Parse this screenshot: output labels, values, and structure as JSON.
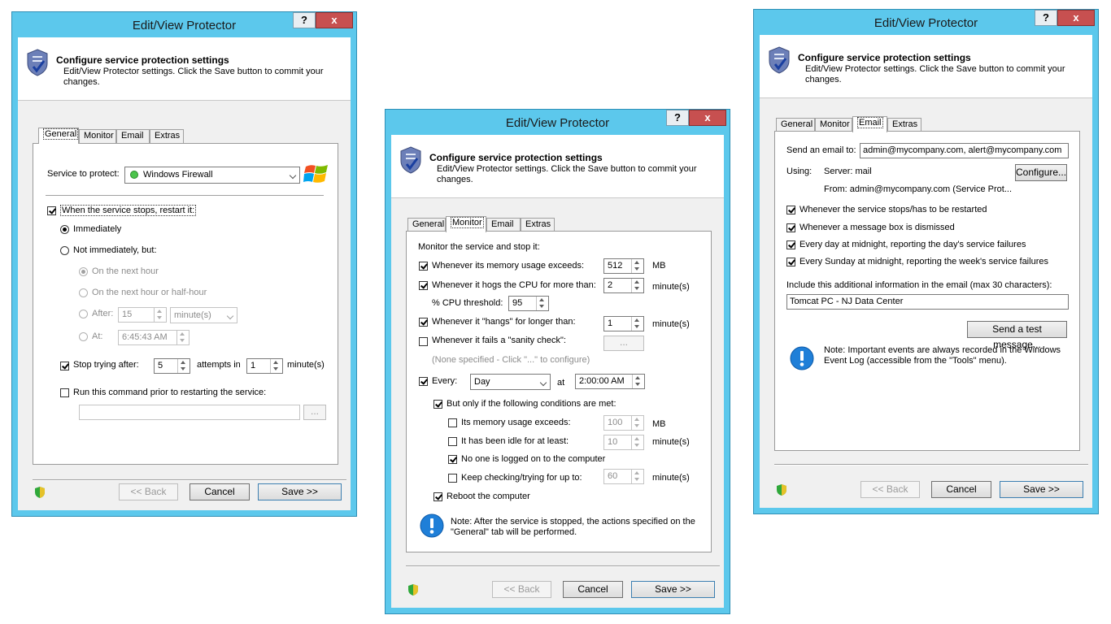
{
  "common": {
    "window_title": "Edit/View Protector",
    "help_label": "?",
    "close_label": "x",
    "header_title": "Configure service protection settings",
    "header_subtitle": "Edit/View Protector settings. Click the Save button to commit your changes.",
    "tabs": [
      "General",
      "Monitor",
      "Email",
      "Extras"
    ],
    "back_label": "<< Back",
    "cancel_label": "Cancel",
    "save_label": "Save >>"
  },
  "general": {
    "active_tab": "General",
    "service_label": "Service to protect:",
    "service_value": "Windows Firewall",
    "restart_label": "When the service stops, restart it:",
    "restart_checked": true,
    "immediately_label": "Immediately",
    "not_immediately_label": "Not immediately, but:",
    "next_hour_label": "On the next hour",
    "next_half_hour_label": "On the next hour or half-hour",
    "after_label": "After:",
    "after_value": "15",
    "after_unit": "minute(s)",
    "at_label": "At:",
    "at_value": "6:45:43 AM",
    "stop_trying_label": "Stop trying after:",
    "stop_trying_value": "5",
    "attempts_in_label": "attempts in",
    "attempts_in_value": "1",
    "attempts_unit": "minute(s)",
    "run_command_label": "Run this command prior to restarting the service:",
    "browse_label": "..."
  },
  "monitor": {
    "active_tab": "Monitor",
    "intro": "Monitor the service and stop it:",
    "memory_label": "Whenever its memory usage exceeds:",
    "memory_value": "512",
    "memory_unit": "MB",
    "cpu_label": "Whenever it hogs the CPU for more than:",
    "cpu_value": "2",
    "cpu_unit": "minute(s)",
    "cpu_threshold_label": "% CPU threshold:",
    "cpu_threshold_value": "95",
    "hangs_label": "Whenever it \"hangs\" for longer than:",
    "hangs_value": "1",
    "hangs_unit": "minute(s)",
    "sanity_label": "Whenever it fails a \"sanity check\":",
    "sanity_button": "...",
    "sanity_hint": "(None specified - Click \"...\" to configure)",
    "every_label": "Every:",
    "every_value": "Day",
    "at_label": "at",
    "at_value": "2:00:00 AM",
    "conditions_label": "But only if the following conditions are met:",
    "cond_memory_label": "Its memory usage exceeds:",
    "cond_memory_value": "100",
    "cond_memory_unit": "MB",
    "cond_idle_label": "It has been idle for at least:",
    "cond_idle_value": "10",
    "cond_idle_unit": "minute(s)",
    "cond_logged_label": "No one is logged on to the computer",
    "cond_keep_label": "Keep checking/trying for up to:",
    "cond_keep_value": "60",
    "cond_keep_unit": "minute(s)",
    "reboot_label": "Reboot the computer",
    "note": "Note: After the service is stopped, the actions specified on the \"General\" tab will be performed."
  },
  "email": {
    "active_tab": "Email",
    "send_to_label": "Send an email to:",
    "send_to_value": "admin@mycompany.com, alert@mycompany.com",
    "using_label": "Using:",
    "server_text": "Server: mail",
    "configure_label": "Configure...",
    "from_text": "From: admin@mycompany.com (Service Prot...",
    "opt1": "Whenever the service stops/has to be restarted",
    "opt2": "Whenever a message box is dismissed",
    "opt3": "Every day at midnight, reporting the day's service failures",
    "opt4": "Every Sunday at midnight, reporting the week's service failures",
    "additional_label": "Include this additional information in the email (max 30 characters):",
    "additional_value": "Tomcat PC - NJ Data Center",
    "test_label": "Send a test message...",
    "note": "Note: Important events are always recorded in the Windows Event Log (accessible from the \"Tools\" menu)."
  }
}
